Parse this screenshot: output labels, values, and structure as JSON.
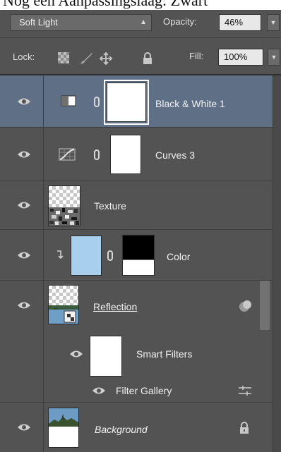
{
  "caption_fragment": "Nog een Aanpassingslaag: Zwart",
  "options": {
    "blend_mode": "Soft Light",
    "opacity_label": "Opacity:",
    "opacity_value": "46%",
    "lock_label": "Lock:",
    "fill_label": "Fill:",
    "fill_value": "100%"
  },
  "layers": [
    {
      "name": "Black & White 1",
      "selected": true,
      "kind": "adjustment-black-white"
    },
    {
      "name": "Curves 3",
      "kind": "adjustment-curves"
    },
    {
      "name": "Texture",
      "kind": "pixel"
    },
    {
      "name": "Color",
      "kind": "clipped-fill"
    },
    {
      "name": "Reflection",
      "kind": "smart-object",
      "filters_label": "Smart Filters",
      "filter_name": "Filter Gallery"
    },
    {
      "name": "Background",
      "kind": "background",
      "locked": true
    }
  ],
  "colors": {
    "panel": "#535353",
    "selected_row": "#5e6f86",
    "color_fill": "#a9cfee"
  }
}
